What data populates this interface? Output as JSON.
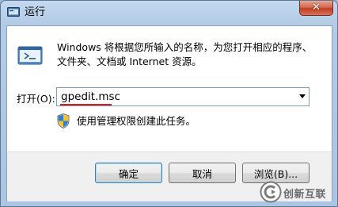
{
  "window": {
    "title": "运行",
    "close_symbol": "✕"
  },
  "dialog": {
    "description_line1": "Windows 将根据您所输入的名称，为您打开相应的程序、",
    "description_line2": "文件夹、文档或 Internet 资源。",
    "open_label": "打开(O):",
    "command_value": "gpedit.msc",
    "admin_note": "使用管理权限创建此任务。"
  },
  "buttons": {
    "ok": "确定",
    "cancel": "取消",
    "browse": "浏览(B)..."
  },
  "watermark": {
    "text": "创新互联"
  },
  "icons": {
    "title": "run-app-icon",
    "run": "run-program-icon",
    "shield": "uac-shield-icon",
    "logo": "watermark-logo-icon"
  },
  "colors": {
    "underline": "#d51c1c",
    "default_button_border": "#3c7fb1"
  }
}
